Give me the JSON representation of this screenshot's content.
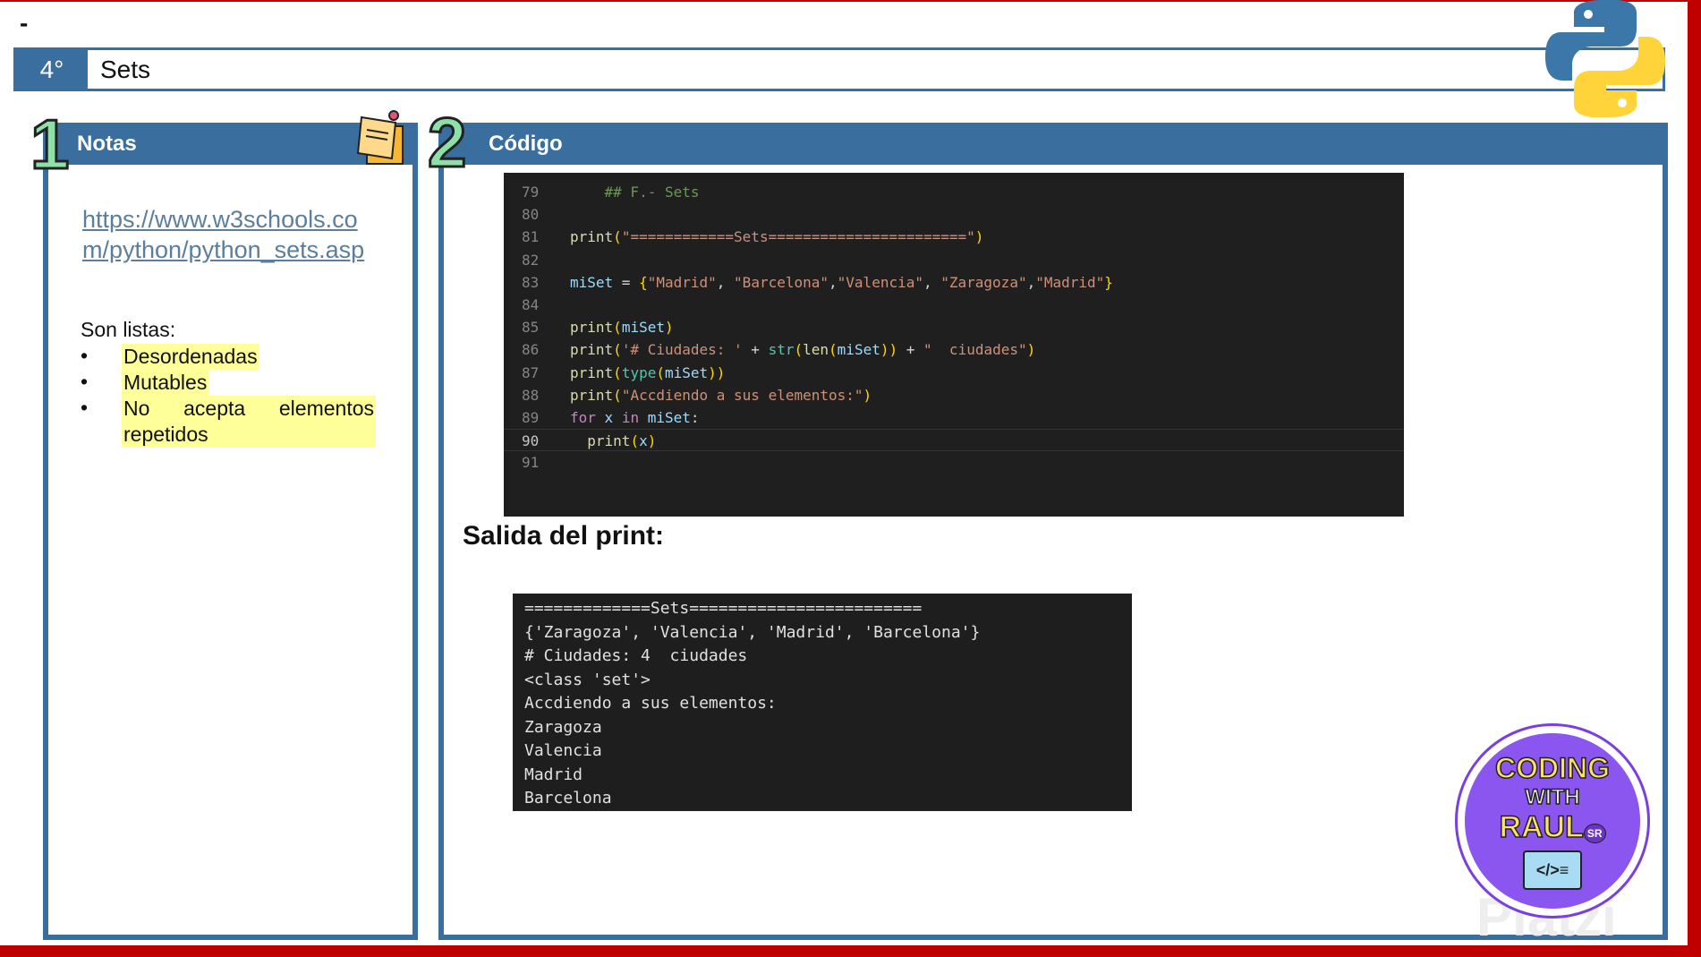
{
  "header": {
    "dash": "-",
    "number": "4°",
    "title": "Sets"
  },
  "notas": {
    "title": "Notas",
    "number": "1",
    "link": "https://www.w3schools.com/python/python_sets.asp",
    "intro": "Son listas:",
    "bullets": [
      "Desordenadas",
      "Mutables",
      "No acepta elementos repetidos"
    ]
  },
  "codigo": {
    "title": "Código",
    "number": "2",
    "lines": [
      {
        "n": "79",
        "code": "## F.- Sets"
      },
      {
        "n": "80",
        "code": ""
      },
      {
        "n": "81",
        "code": "print(\"============Sets=======================\")"
      },
      {
        "n": "82",
        "code": ""
      },
      {
        "n": "83",
        "code": "miSet = {\"Madrid\", \"Barcelona\",\"Valencia\", \"Zaragoza\",\"Madrid\"}"
      },
      {
        "n": "84",
        "code": ""
      },
      {
        "n": "85",
        "code": "print(miSet)"
      },
      {
        "n": "86",
        "code": "print('# Ciudades: ' + str(len(miSet)) + \"  ciudades\")"
      },
      {
        "n": "87",
        "code": "print(type(miSet))"
      },
      {
        "n": "88",
        "code": "print(\"Accdiendo a sus elementos:\")"
      },
      {
        "n": "89",
        "code": "for x in miSet:"
      },
      {
        "n": "90",
        "code": "  print(x)"
      },
      {
        "n": "91",
        "code": ""
      }
    ],
    "output_title": "Salida del print:",
    "output": [
      "=============Sets========================",
      "{'Zaragoza', 'Valencia', 'Madrid', 'Barcelona'}",
      "# Ciudades: 4  ciudades",
      "<class 'set'>",
      "Accdiendo a sus elementos:",
      "Zaragoza",
      "Valencia",
      "Madrid",
      "Barcelona"
    ]
  },
  "logo": {
    "line1": "CODING",
    "line2": "WITH",
    "line3": "RAUL",
    "badge": "SR"
  },
  "watermark": "Platzi",
  "colors": {
    "accent": "#3a6e9f",
    "border_red": "#c00000",
    "highlight": "#ffff9a",
    "code_bg": "#1f1f1f"
  }
}
